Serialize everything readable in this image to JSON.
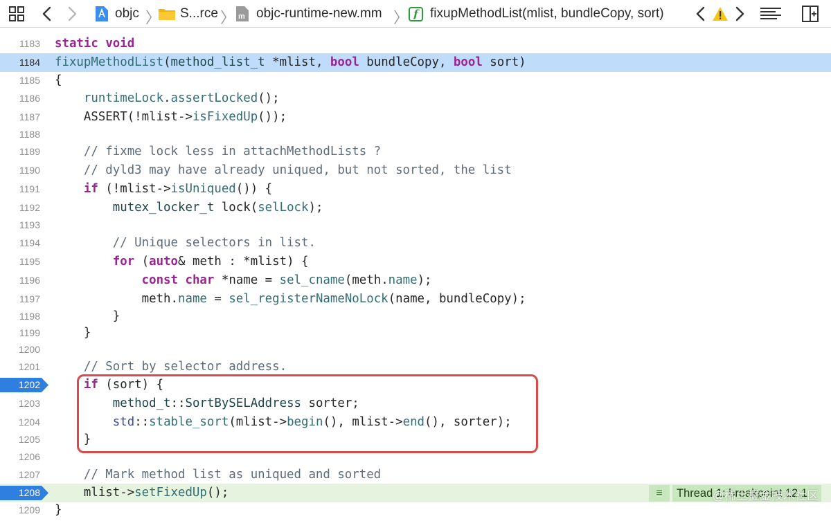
{
  "jumpbar": {
    "crumbs": [
      "objc",
      "S...rce",
      "objc-runtime-new.mm",
      "fixupMethodList(mlist, bundleCopy, sort)"
    ],
    "func_glyph": "f"
  },
  "lines": [
    {
      "n": "1183"
    },
    {
      "n": "1184"
    },
    {
      "n": "1185"
    },
    {
      "n": "1186"
    },
    {
      "n": "1187"
    },
    {
      "n": "1188"
    },
    {
      "n": "1189"
    },
    {
      "n": "1190"
    },
    {
      "n": "1191"
    },
    {
      "n": "1192"
    },
    {
      "n": "1193"
    },
    {
      "n": "1194"
    },
    {
      "n": "1195"
    },
    {
      "n": "1196"
    },
    {
      "n": "1197"
    },
    {
      "n": "1198"
    },
    {
      "n": "1199"
    },
    {
      "n": "1200"
    },
    {
      "n": "1201"
    },
    {
      "n": "1202"
    },
    {
      "n": "1203"
    },
    {
      "n": "1204"
    },
    {
      "n": "1205"
    },
    {
      "n": "1206"
    },
    {
      "n": "1207"
    },
    {
      "n": "1208"
    },
    {
      "n": "1209"
    }
  ],
  "code": {
    "l1183": [
      "static",
      " ",
      "void"
    ],
    "l1184": [
      "fixupMethodList",
      "(",
      "method_list_t",
      " *mlist, ",
      "bool",
      " bundleCopy, ",
      "bool",
      " sort)"
    ],
    "l1185": [
      "{"
    ],
    "l1186": [
      "    ",
      "runtimeLock",
      ".",
      "assertLocked",
      "();"
    ],
    "l1187": [
      "    ASSERT(!mlist->",
      "isFixedUp",
      "());"
    ],
    "l1188": [
      ""
    ],
    "l1189": [
      "    // fixme lock less in attachMethodLists ?"
    ],
    "l1190": [
      "    // dyld3 may have already uniqued, but not sorted, the list"
    ],
    "l1191": [
      "    ",
      "if",
      " (!mlist->",
      "isUniqued",
      "()) {"
    ],
    "l1192": [
      "        ",
      "mutex_locker_t",
      " lock(",
      "selLock",
      ");"
    ],
    "l1193": [
      ""
    ],
    "l1194": [
      "        // Unique selectors in list."
    ],
    "l1195": [
      "        ",
      "for",
      " (",
      "auto",
      "& meth : *mlist) {"
    ],
    "l1196": [
      "            ",
      "const",
      " ",
      "char",
      " *name = ",
      "sel_cname",
      "(meth.",
      "name",
      ");"
    ],
    "l1197": [
      "            meth.",
      "name",
      " = ",
      "sel_registerNameNoLock",
      "(name, bundleCopy);"
    ],
    "l1198": [
      "        }"
    ],
    "l1199": [
      "    }"
    ],
    "l1200": [
      ""
    ],
    "l1201": [
      "    // Sort by selector address."
    ],
    "l1202": [
      "    ",
      "if",
      " (sort) {"
    ],
    "l1203": [
      "        ",
      "method_t",
      "::",
      "SortBySELAddress",
      " sorter;"
    ],
    "l1204": [
      "        ",
      "std",
      "::",
      "stable_sort",
      "(mlist->",
      "begin",
      "(), mlist->",
      "end",
      "(), sorter);"
    ],
    "l1205": [
      "    }"
    ],
    "l1206": [
      ""
    ],
    "l1207": [
      "    // Mark method list as uniqued and sorted"
    ],
    "l1208": [
      "    mlist->",
      "setFixedUp",
      "();"
    ],
    "l1209": [
      "}"
    ]
  },
  "breakpoints": [
    "1202",
    "1208"
  ],
  "thread_badge": {
    "icon": "≡",
    "label": "Thread 1: breakpoint 12.1"
  },
  "watermark": "@稀土掘金技术社区",
  "colors": {
    "keyword": "#9b2393",
    "function": "#326d74",
    "comment": "#5d6c79",
    "current_line": "#bfdcfb",
    "exec_line": "#e5f3df",
    "breakpoint": "#2f7fe0",
    "highlight_box": "#d94a4a"
  }
}
